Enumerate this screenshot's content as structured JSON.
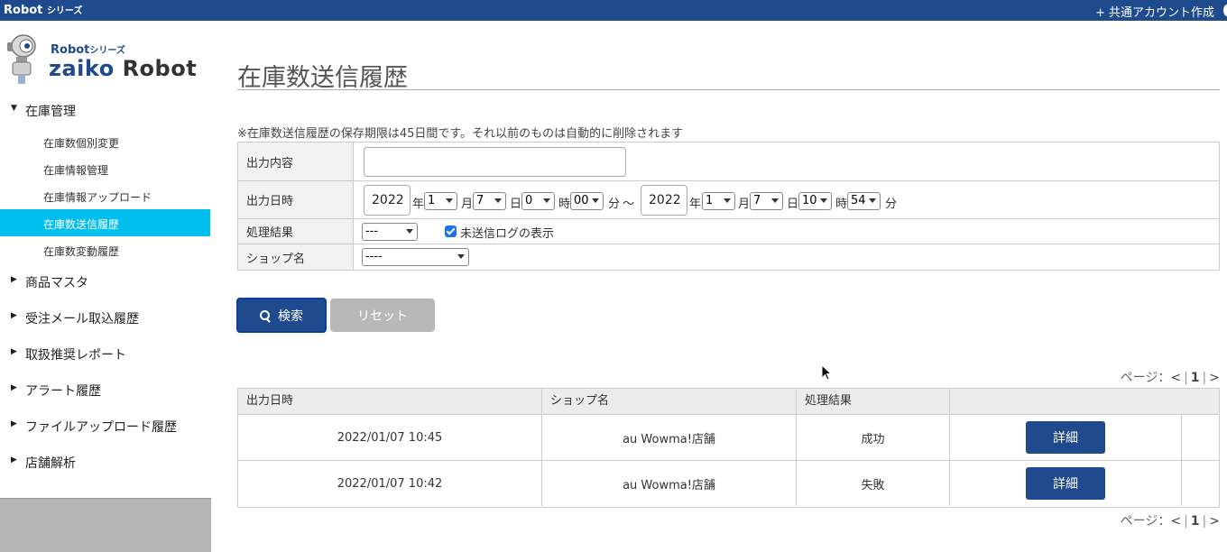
{
  "topbar": {
    "brand": "Robot",
    "brand_suffix": "シリーズ",
    "create_label": "共通アカウント作成",
    "create_icon": "plus-icon"
  },
  "logo": {
    "sub": "Robot",
    "sub_suffix": "シリーズ",
    "main": "zaiko",
    "main_suffix": "Robot"
  },
  "sidebar": {
    "sections": [
      {
        "label": "在庫管理",
        "expanded": true
      },
      {
        "label": "商品マスタ"
      },
      {
        "label": "受注メール取込履歴"
      },
      {
        "label": "取扱推奨レポート"
      },
      {
        "label": "アラート履歴"
      },
      {
        "label": "ファイルアップロード履歴"
      },
      {
        "label": "店舗解析"
      }
    ],
    "subitems": [
      {
        "label": "在庫数個別変更"
      },
      {
        "label": "在庫情報管理"
      },
      {
        "label": "在庫情報アップロード"
      },
      {
        "label": "在庫数送信履歴",
        "active": true
      },
      {
        "label": "在庫数変動履歴"
      }
    ]
  },
  "page": {
    "title": "在庫数送信履歴",
    "notice": "※在庫数送信履歴の保存期限は45日間です。それ以前のものは自動的に削除されます"
  },
  "form": {
    "output_content_label": "出力内容",
    "output_content_value": "",
    "datetime_label": "出力日時",
    "from": {
      "year": "2022",
      "month": "1",
      "day": "7",
      "hour": "0",
      "minute": "00"
    },
    "to": {
      "year": "2022",
      "month": "1",
      "day": "7",
      "hour": "10",
      "minute": "54"
    },
    "units": {
      "year": "年",
      "month": "月",
      "day": "日",
      "hour": "時",
      "minute": "分",
      "range": "〜"
    },
    "result_label": "処理結果",
    "result_value": "---",
    "unsent_checkbox_label": "未送信ログの表示",
    "unsent_checked": true,
    "shop_label": "ショップ名",
    "shop_value": "----"
  },
  "buttons": {
    "search": "検索",
    "reset": "リセット"
  },
  "pager": {
    "label": "ページ：",
    "prev": "<",
    "current": "1",
    "next": ">"
  },
  "table": {
    "headers": [
      "出力日時",
      "ショップ名",
      "処理結果",
      ""
    ],
    "rows": [
      {
        "datetime": "2022/01/07 10:45",
        "shop": "au Wowma!店舗",
        "result": "成功",
        "action": "詳細"
      },
      {
        "datetime": "2022/01/07 10:42",
        "shop": "au Wowma!店舗",
        "result": "失敗",
        "action": "詳細"
      }
    ]
  },
  "colors": {
    "brand": "#1f4b8e",
    "active_nav": "#00bfee",
    "reset_button": "#b8b8b8"
  }
}
